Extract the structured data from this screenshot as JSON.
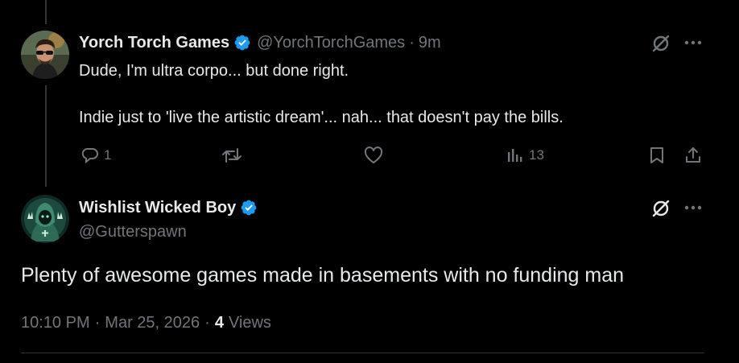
{
  "reply_tweet": {
    "display_name": "Yorch Torch Games",
    "handle": "@YorchTorchGames",
    "separator": "·",
    "time": "9m",
    "text_line1": "Dude, I'm ultra corpo... but done right.",
    "text_line2": "Indie just to 'live the artistic dream'... nah... that doesn't pay the bills.",
    "actions": {
      "reply_count": "1",
      "retweet_count": "",
      "like_count": "",
      "views_count": "13"
    },
    "icons": [
      "grok-icon",
      "more-icon",
      "reply-icon",
      "retweet-icon",
      "like-icon",
      "views-icon",
      "bookmark-icon",
      "share-icon"
    ]
  },
  "main_tweet": {
    "display_name": "Wishlist Wicked Boy",
    "handle": "@Gutterspawn",
    "text": "Plenty of awesome games made in basements with no funding man",
    "time": "10:10 PM",
    "date": "Mar 25, 2026",
    "separator": "·",
    "views_count": "4",
    "views_label": "Views",
    "icons": [
      "grok-icon",
      "more-icon"
    ]
  },
  "colors": {
    "background": "#000000",
    "primary_text": "#e7e9ea",
    "secondary_text": "#71767b",
    "verified": "#1d9bf0",
    "divider": "#2f3336"
  }
}
